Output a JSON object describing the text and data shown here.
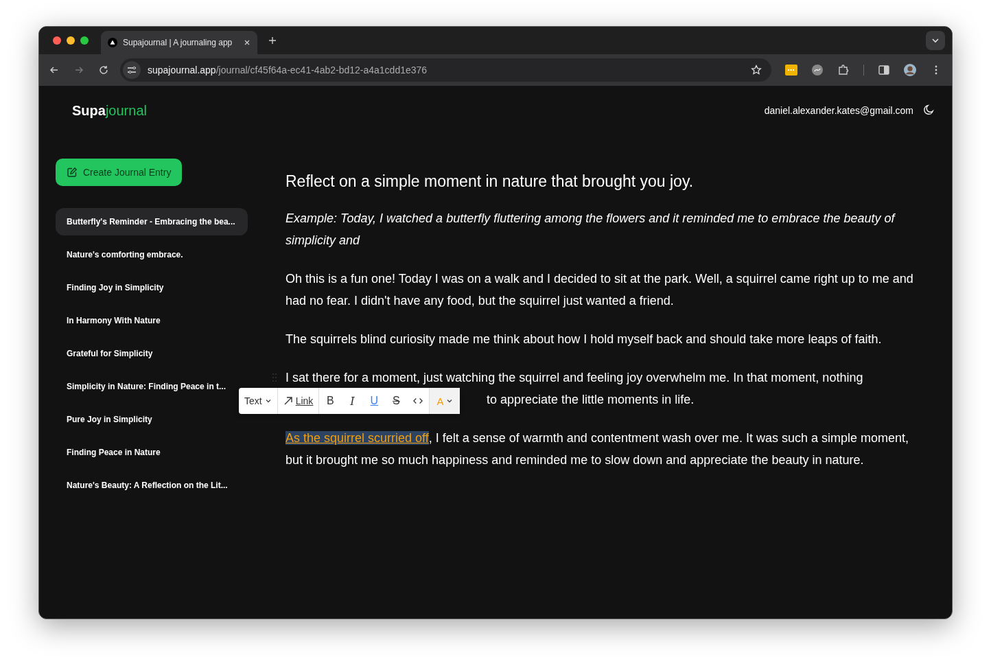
{
  "browser": {
    "tab_title": "Supajournal | A journaling app",
    "url_host": "supajournal.app",
    "url_path": "/journal/cf45f64a-ec41-4ab2-bd12-a4a1cdd1e376"
  },
  "app": {
    "logo_first": "Supa",
    "logo_second": "journal",
    "user_email": "daniel.alexander.kates@gmail.com"
  },
  "create_button": "Create Journal Entry",
  "entries": [
    {
      "title": "Butterfly's Reminder - Embracing the bea...",
      "selected": true
    },
    {
      "title": "Nature's comforting embrace.",
      "selected": false
    },
    {
      "title": "Finding Joy in Simplicity",
      "selected": false
    },
    {
      "title": "In Harmony With Nature",
      "selected": false
    },
    {
      "title": "Grateful for Simplicity",
      "selected": false
    },
    {
      "title": "Simplicity in Nature: Finding Peace in t...",
      "selected": false
    },
    {
      "title": "Pure Joy in Simplicity",
      "selected": false
    },
    {
      "title": "Finding Peace in Nature",
      "selected": false
    },
    {
      "title": "Nature's Beauty: A Reflection on the Lit...",
      "selected": false
    }
  ],
  "prompt": "Reflect on a simple moment in nature that brought you joy.",
  "example": "Example: Today, I watched a butterfly fluttering among the flowers and it reminded me to embrace the beauty of simplicity and",
  "paragraphs": [
    {
      "kind": "plain",
      "text": "Oh this is a fun one! Today I was on a walk and I decided to sit at the park. Well, a squirrel came right up to me and had no fear. I didn't have any food, but the squirrel just wanted a friend."
    },
    {
      "kind": "plain",
      "text": "The squirrels blind curiosity made me think about how I hold myself back and should take more leaps of faith."
    },
    {
      "kind": "covered",
      "text": "I sat there for a moment, just watching the squirrel and feeling joy overwhelm me. In that moment, nothing",
      "after": "to appreciate the little moments in life."
    },
    {
      "kind": "selection",
      "selected_text": "As the squirrel scurried off",
      "text": ", I felt a sense of warmth and contentment wash over me. It was such a simple moment, but it brought me so much happiness and reminded me to slow down and appreciate the beauty in nature."
    }
  ],
  "toolbar": {
    "block_type": "Text",
    "link": "Link",
    "buttons": [
      {
        "kind": "bold",
        "label": "B",
        "active": false
      },
      {
        "kind": "italic",
        "label": "I",
        "active": false
      },
      {
        "kind": "underline",
        "label": "U",
        "active": true
      },
      {
        "kind": "strike",
        "label": "S",
        "active": false
      },
      {
        "kind": "code",
        "active": false
      }
    ],
    "color_label": "A",
    "color": "#f59e0b"
  }
}
